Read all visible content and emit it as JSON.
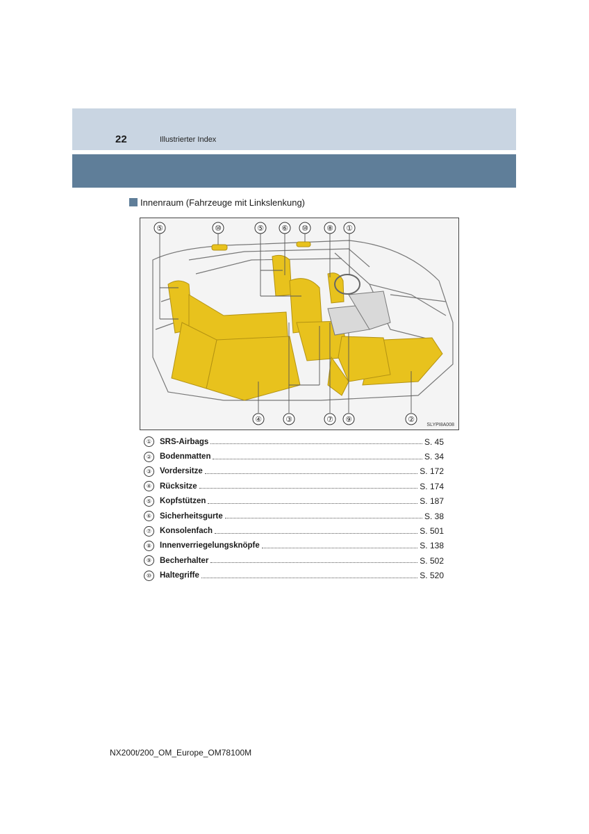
{
  "header": {
    "page_number": "22",
    "title": "Illustrierter Index"
  },
  "section": {
    "title": "Innenraum (Fahrzeuge mit Linkslenkung)"
  },
  "figure": {
    "code": "SLYPI8A008",
    "callouts_top": [
      "⑤",
      "⑩",
      "⑤",
      "⑥",
      "⑩",
      "⑧",
      "①"
    ],
    "callouts_bottom": [
      "④",
      "③",
      "⑦",
      "⑨",
      "②"
    ],
    "colors": {
      "seat_fill": "#e8c21d",
      "seat_shade": "#b39212",
      "line": "#555555"
    }
  },
  "index": {
    "items": [
      {
        "num": "①",
        "label": "SRS-Airbags",
        "page": "S. 45"
      },
      {
        "num": "②",
        "label": "Bodenmatten",
        "page": "S. 34"
      },
      {
        "num": "③",
        "label": "Vordersitze",
        "page": "S. 172"
      },
      {
        "num": "④",
        "label": "Rücksitze",
        "page": "S. 174"
      },
      {
        "num": "⑤",
        "label": "Kopfstützen",
        "page": "S. 187"
      },
      {
        "num": "⑥",
        "label": "Sicherheitsgurte",
        "page": "S. 38"
      },
      {
        "num": "⑦",
        "label": "Konsolenfach",
        "page": "S. 501"
      },
      {
        "num": "⑧",
        "label": "Innenverriegelungsknöpfe",
        "page": "S. 138"
      },
      {
        "num": "⑨",
        "label": "Becherhalter",
        "page": "S. 502"
      },
      {
        "num": "⑩",
        "label": "Haltegriffe",
        "page": "S. 520"
      }
    ]
  },
  "footer": {
    "doc_id": "NX200t/200_OM_Europe_OM78100M"
  }
}
